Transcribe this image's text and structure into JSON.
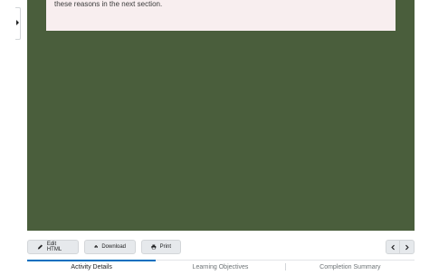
{
  "note": {
    "text": "these reasons in the next section."
  },
  "toolbar": {
    "edit_label": "Edit HTML",
    "download_label": "Download",
    "print_label": "Print"
  },
  "tabs": [
    {
      "label": "Activity Details",
      "active": true
    },
    {
      "label": "Learning Objectives",
      "active": false
    },
    {
      "label": "Completion Summary",
      "active": false
    }
  ],
  "icons": {
    "edit": "pencil-icon",
    "download": "cloud-download-icon",
    "print": "printer-icon",
    "prev": "chevron-left-icon",
    "next": "chevron-right-icon",
    "side": "caret-right-icon"
  },
  "colors": {
    "content_bg": "#4a5e3c",
    "note_bg": "#f8eeef",
    "tab_accent": "#006fbf"
  }
}
